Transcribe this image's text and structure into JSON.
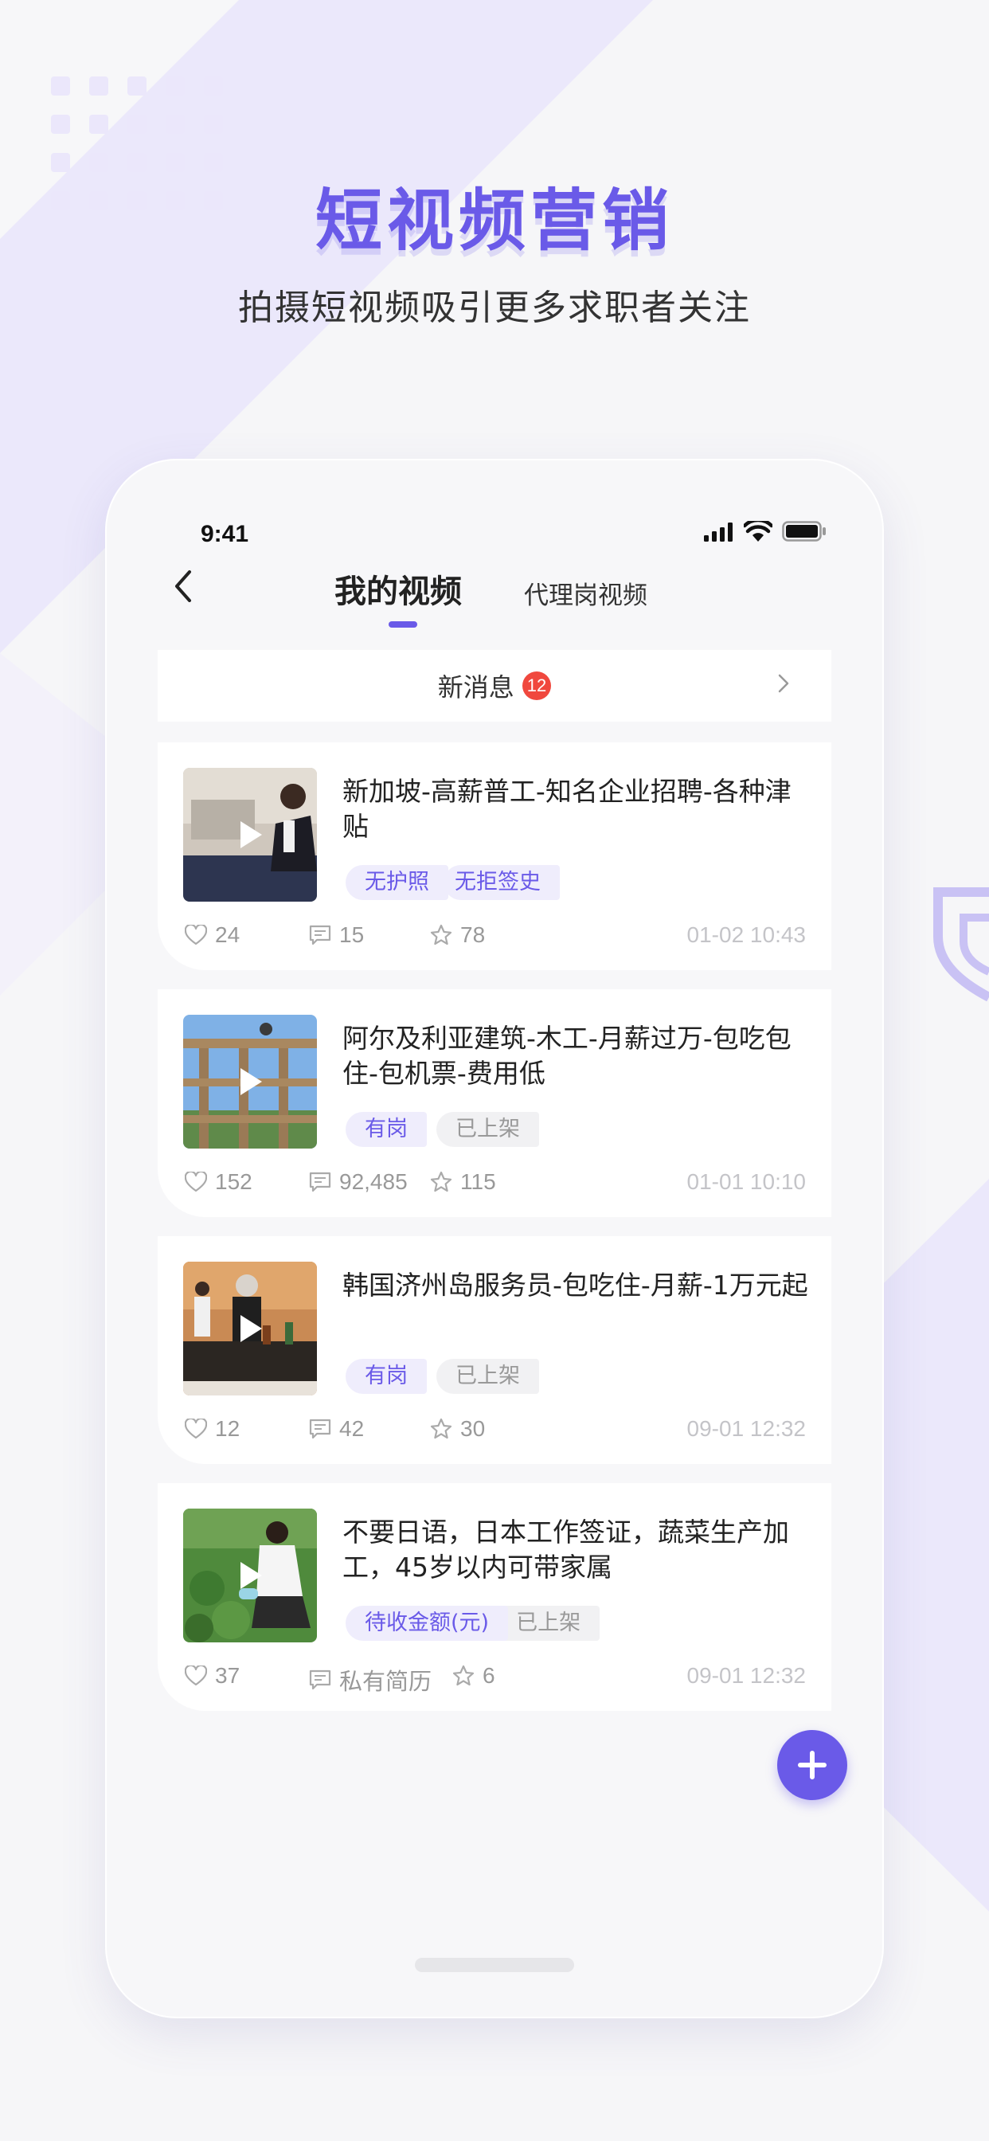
{
  "hero": {
    "title": "短视频营销",
    "subtitle": "拍摄短视频吸引更多求职者关注"
  },
  "status_bar": {
    "time": "9:41"
  },
  "nav": {
    "tab_active": "我的视频",
    "tab_other": "代理岗视频"
  },
  "message_bar": {
    "label": "新消息",
    "badge": "12"
  },
  "videos": [
    {
      "title": "新加坡-高薪普工-知名企业招聘-各种津贴",
      "tag1": "无护照",
      "tag2": "无拒签史",
      "likes": "24",
      "comments": "15",
      "favorites": "78",
      "time": "01-02 10:43"
    },
    {
      "title": "阿尔及利亚建筑-木工-月薪过万-包吃包住-包机票-费用低",
      "tag1": "有岗",
      "tag2": "已上架",
      "likes": "152",
      "comments": "92,485",
      "favorites": "115",
      "time": "01-01 10:10"
    },
    {
      "title": "韩国济州岛服务员-包吃住-月薪-1万元起",
      "tag1": "有岗",
      "tag2": "已上架",
      "likes": "12",
      "comments": "42",
      "favorites": "30",
      "time": "09-01 12:32"
    },
    {
      "title": "不要日语，日本工作签证，蔬菜生产加工，45岁以内可带家属",
      "tag1": "待收金额(元)",
      "tag2": "已上架",
      "likes": "37",
      "comments": "私有简历",
      "favorites": "6",
      "time": "09-01 12:32"
    }
  ],
  "colors": {
    "accent": "#6a5ae8",
    "badge": "#f0483e",
    "background_decor": "#e9e6fb"
  },
  "icons": [
    "back-icon",
    "signal-icon",
    "wifi-icon",
    "battery-icon",
    "chevron-right-icon",
    "play-icon",
    "heart-icon",
    "comment-icon",
    "star-icon",
    "plus-icon",
    "shield-decor-icon"
  ]
}
